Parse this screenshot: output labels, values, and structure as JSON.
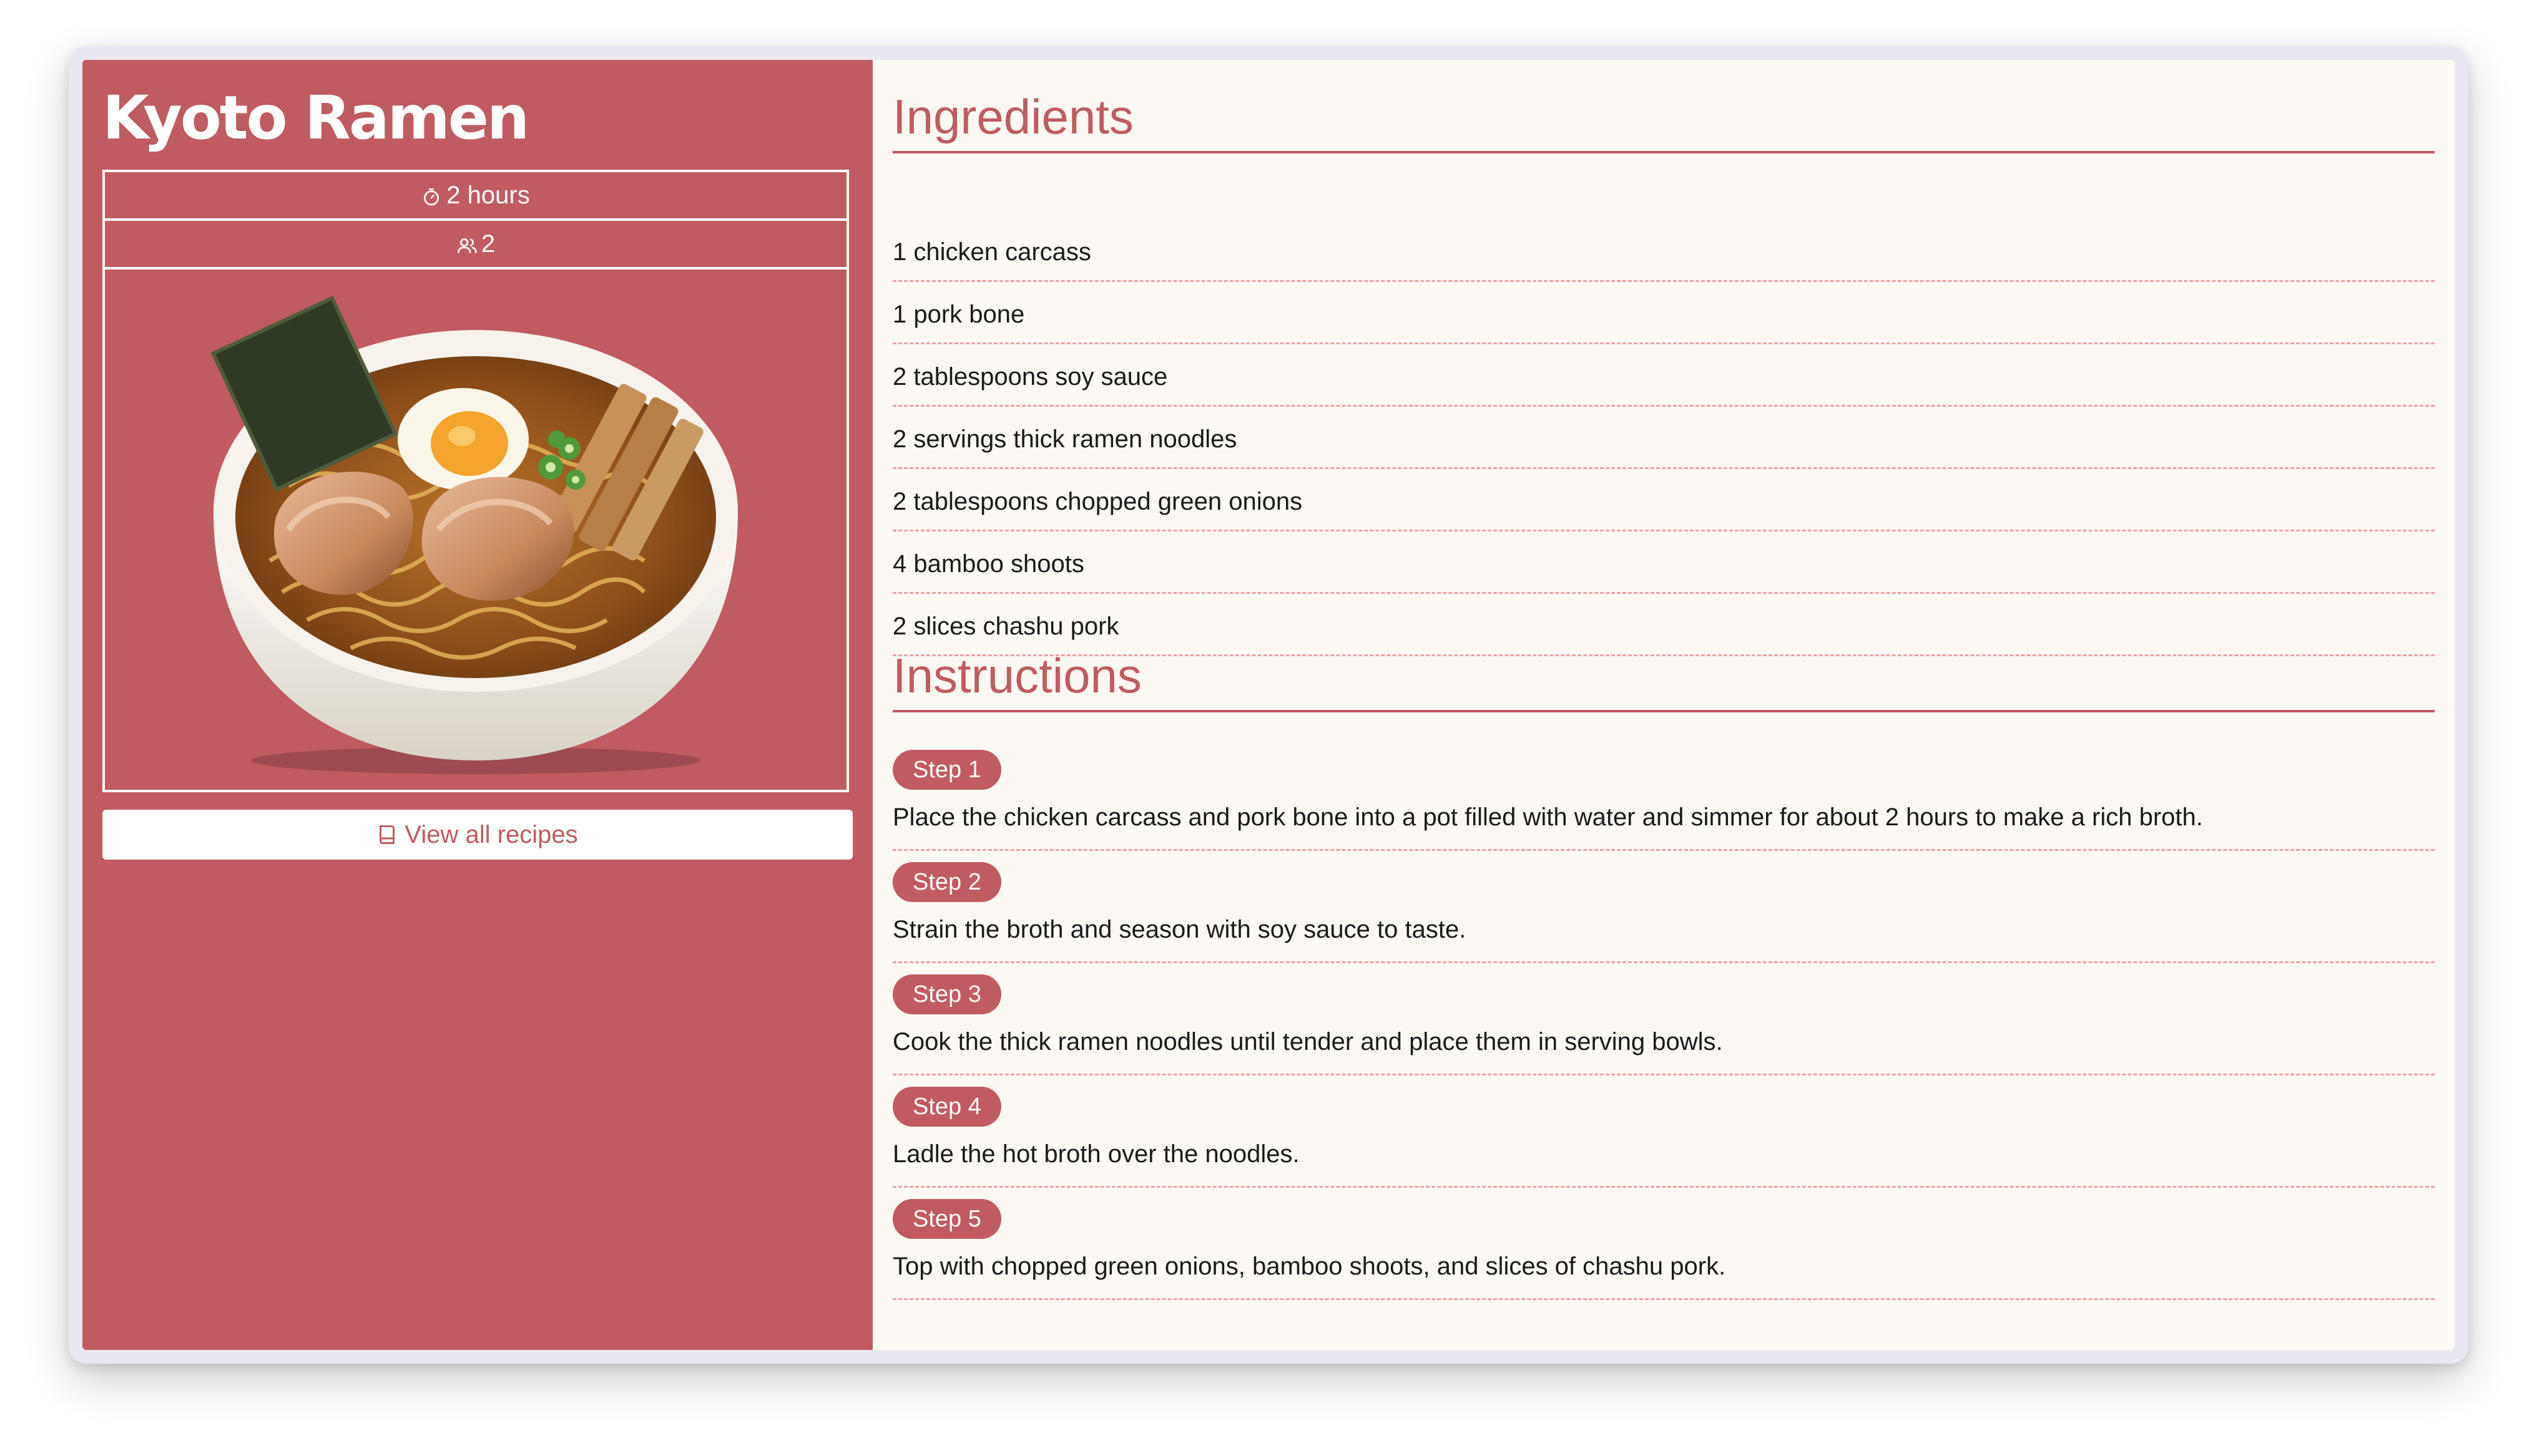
{
  "recipe": {
    "title": "Kyoto Ramen",
    "time": "2 hours",
    "servings": "2",
    "view_all_label": "View all recipes",
    "accent_color": "#c05b62",
    "background_color": "#fcf9f4"
  },
  "icons": {
    "time": "timer-icon",
    "servings": "users-icon",
    "view_all": "book-icon"
  },
  "ingredients": {
    "title": "Ingredients",
    "items": [
      "1 chicken carcass",
      "1 pork bone",
      "2 tablespoons soy sauce",
      "2 servings thick ramen noodles",
      "2 tablespoons chopped green onions",
      "4 bamboo shoots",
      "2 slices chashu pork"
    ]
  },
  "instructions": {
    "title": "Instructions",
    "steps": [
      {
        "label": "Step 1",
        "text": "Place the chicken carcass and pork bone into a pot filled with water and simmer for about 2 hours to make a rich broth."
      },
      {
        "label": "Step 2",
        "text": "Strain the broth and season with soy sauce to taste."
      },
      {
        "label": "Step 3",
        "text": "Cook the thick ramen noodles until tender and place them in serving bowls."
      },
      {
        "label": "Step 4",
        "text": "Ladle the hot broth over the noodles."
      },
      {
        "label": "Step 5",
        "text": "Top with chopped green onions, bamboo shoots, and slices of chashu pork."
      }
    ]
  }
}
